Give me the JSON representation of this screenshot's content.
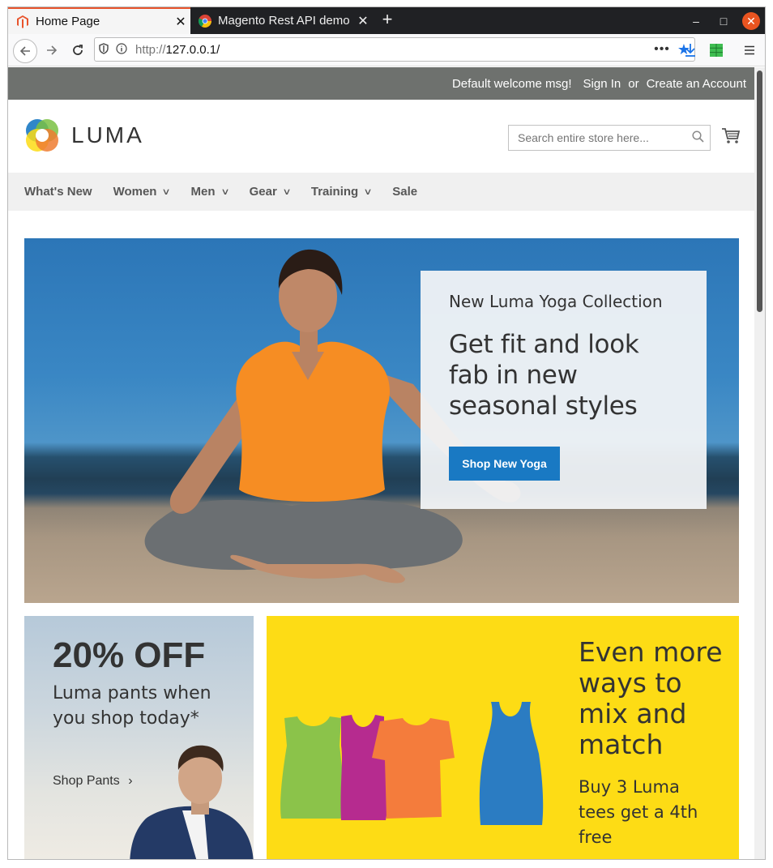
{
  "browser": {
    "tabs": [
      {
        "title": "Home Page",
        "active": true,
        "favicon": "magento-icon"
      },
      {
        "title": "Magento Rest API demo",
        "active": false,
        "favicon": "chrome-icon"
      }
    ],
    "new_tab_label": "+",
    "url_protocol": "http://",
    "url_host": "127.0.0.1/",
    "page_actions": "•••"
  },
  "panel": {
    "welcome": "Default welcome msg!",
    "sign_in": "Sign In",
    "or": "or",
    "create_account": "Create an Account"
  },
  "header": {
    "logo_text": "LUMA",
    "search_placeholder": "Search entire store here..."
  },
  "nav": {
    "items": [
      {
        "label": "What's New",
        "has_dropdown": false
      },
      {
        "label": "Women",
        "has_dropdown": true
      },
      {
        "label": "Men",
        "has_dropdown": true
      },
      {
        "label": "Gear",
        "has_dropdown": true
      },
      {
        "label": "Training",
        "has_dropdown": true
      },
      {
        "label": "Sale",
        "has_dropdown": false
      }
    ]
  },
  "hero": {
    "kicker": "New Luma Yoga Collection",
    "headline": "Get fit and look fab in new seasonal styles",
    "button": "Shop New Yoga"
  },
  "promo_pants": {
    "title": "20% OFF",
    "subtitle": "Luma pants when you shop today*",
    "link": "Shop Pants",
    "link_arrow": "›"
  },
  "promo_tees": {
    "title": "Even more ways to mix and match",
    "subtitle": "Buy 3 Luma tees get a 4th free"
  },
  "colors": {
    "primary_button": "#1979c3",
    "panel_header": "#6e716e",
    "nav_bg": "#f0f0f0",
    "tees_bg": "#fddc15",
    "tab_accent": "#e8542c"
  }
}
